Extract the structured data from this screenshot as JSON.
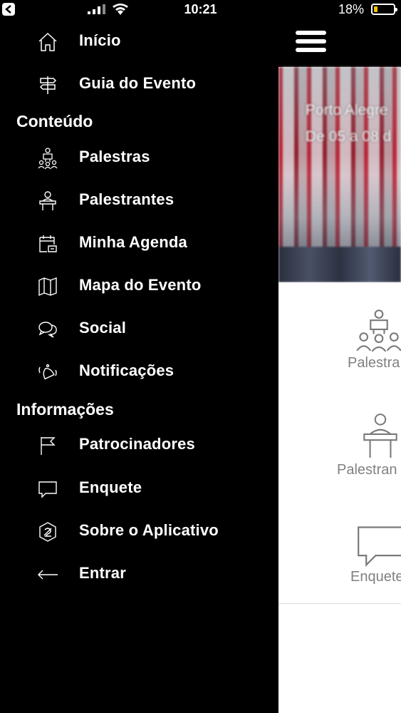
{
  "status_bar": {
    "time": "10:21",
    "battery_percent": "18%",
    "battery_level": 0.18,
    "battery_color": "#f5c400"
  },
  "drawer": {
    "items_top": [
      {
        "label": "Início",
        "icon": "home-icon"
      },
      {
        "label": "Guia do Evento",
        "icon": "signpost-icon"
      }
    ],
    "section_content": "Conteúdo",
    "items_content": [
      {
        "label": "Palestras",
        "icon": "lectures-icon"
      },
      {
        "label": "Palestrantes",
        "icon": "speaker-icon"
      },
      {
        "label": "Minha Agenda",
        "icon": "calendar-icon"
      },
      {
        "label": "Mapa do Evento",
        "icon": "map-icon"
      },
      {
        "label": "Social",
        "icon": "chat-bubbles-icon"
      },
      {
        "label": "Notificações",
        "icon": "bell-icon"
      }
    ],
    "section_info": "Informações",
    "items_info": [
      {
        "label": "Patrocinadores",
        "icon": "flag-icon"
      },
      {
        "label": "Enquete",
        "icon": "speech-bubble-icon"
      },
      {
        "label": "Sobre o Aplicativo",
        "icon": "app-logo-icon"
      },
      {
        "label": "Entrar",
        "icon": "arrow-left-icon"
      }
    ]
  },
  "main": {
    "banner_line1": "Porto Alegre",
    "banner_line2": "De 05 a 08 d",
    "cards": [
      {
        "label": "Palestra",
        "icon": "lectures-icon"
      },
      {
        "label": "Palestran",
        "icon": "speaker-icon"
      },
      {
        "label": "Enquete",
        "icon": "speech-bubble-icon"
      }
    ]
  }
}
